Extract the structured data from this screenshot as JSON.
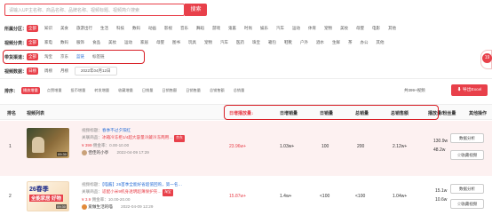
{
  "search": {
    "placeholder": "请输入UP主名称、商品名称、品牌名称、视频标题、视频简介搜索",
    "button": "搜索"
  },
  "filters": {
    "partition": {
      "label": "所属分区：",
      "items": [
        "全部",
        "知识",
        "美食",
        "旅游出行",
        "生活",
        "科技",
        "数码",
        "动画",
        "影视",
        "音乐",
        "舞蹈",
        "游戏",
        "鬼畜",
        "时尚",
        "娱乐",
        "汽车",
        "运动",
        "体育",
        "宠物",
        "美妆",
        "母婴",
        "电影",
        "其他"
      ]
    },
    "category": {
      "label": "视频分类：",
      "items": [
        "全部",
        "家电",
        "数码",
        "服饰",
        "食品",
        "美妆",
        "运动",
        "家居",
        "母婴",
        "图书",
        "玩具",
        "宠物",
        "汽车",
        "医药",
        "珠宝",
        "箱包",
        "鞋靴",
        "户外",
        "酒水",
        "生鲜",
        "茶",
        "办公",
        "其他"
      ]
    },
    "sales_channel": {
      "label": "带货渠道：",
      "items": [
        "全部",
        "淘宝",
        "京东",
        "蓝链",
        "标签链"
      ]
    },
    "time": {
      "label": "视频数据：",
      "items": [
        "日榜",
        "周榜",
        "月榜"
      ],
      "date": "2022年04月12日"
    }
  },
  "sortbar": {
    "label": "排序：",
    "items": [
      "播放增量",
      "点赞增量",
      "投币增量",
      "转发增量",
      "收藏增量",
      "日销量",
      "日销售额",
      "日销售量",
      "总销售额",
      "总销量"
    ],
    "count": "共399+视频",
    "export": "导出Excel"
  },
  "table": {
    "headers": [
      "排名",
      "视频列表",
      "日增播放量↓",
      "日增销量",
      "日销量",
      "总销量",
      "总销售额",
      "播放量/粉丝量",
      "其他操作"
    ],
    "rows": [
      {
        "rank": "1",
        "title_label": "视频标题：",
        "title": "春季不过夕阳红",
        "product_label": "关联商品：",
        "product": "冰箱冷冻柜1/4超大容量冷藏冷冻两用…",
        "tag": "京东",
        "price_label": "¥ 399",
        "price": "佣金率：0.00-10.00",
        "author": "佳佳的小亭",
        "date": "2022-04-09 17:29",
        "duration": "09:30",
        "play": "23.96w+",
        "inc_sales": "1.03w+",
        "daily": "100",
        "total": "200",
        "revenue": "2.12w+",
        "ratio_a": "130.9w",
        "ratio_b": "48.2w",
        "btn1": "数据分析",
        "btn2": "收藏视频"
      },
      {
        "rank": "2",
        "title_label": "视频标题：",
        "title": "【喵酱】26首季全能好省超值回购，第一名…",
        "product_label": "关联商品：",
        "product": "适配小米9机身透明超薄保护壳…",
        "tag": "淘宝",
        "price_label": "¥ 3.9",
        "price": "佣金率：10.00-20.00",
        "author": "爱做生活的喵",
        "date": "2022-04-09 12:29",
        "duration": "09:30",
        "thumb_text1": "26春季",
        "thumb_text2": "全能家居 好物",
        "play": "15.87w+",
        "inc_sales": "1.4w+",
        "daily": "<100",
        "total": "<100",
        "revenue": "1.04w+",
        "ratio_a": "15.1w",
        "ratio_b": "10.6w",
        "btn1": "数据分析",
        "btn2": "收藏视频"
      }
    ]
  },
  "side_badge": "19"
}
